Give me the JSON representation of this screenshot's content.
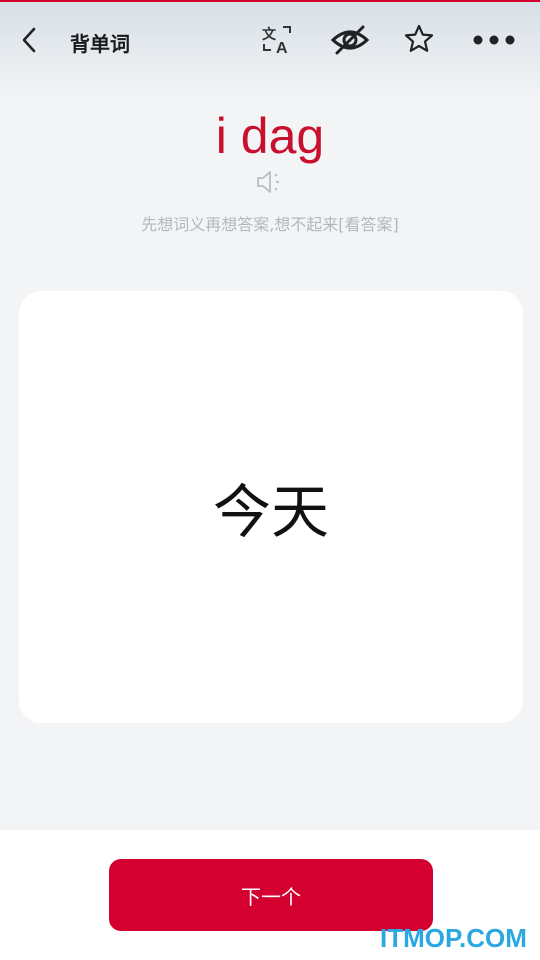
{
  "header": {
    "title": "背单词",
    "icons": [
      "back-arrow-icon",
      "translate-icon",
      "eye-off-icon",
      "star-icon",
      "more-icon"
    ]
  },
  "word": {
    "text": "i dag",
    "hint": "先想词义再想答案,想不起来[看答案]"
  },
  "card": {
    "meaning": "今天"
  },
  "footer": {
    "next_label": "下一个",
    "watermark": "ITMOP.COM"
  },
  "colors": {
    "accent": "#d4002f",
    "word": "#c8102e",
    "hint": "#b3b7bd",
    "watermark": "#2aa8e0"
  }
}
